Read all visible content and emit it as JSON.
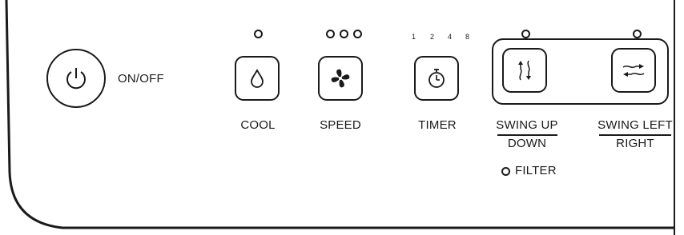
{
  "panel": {
    "power": {
      "label": "ON/OFF",
      "icon": "power-icon"
    },
    "cool": {
      "label": "COOL",
      "icon": "water-drop-icon",
      "indicators": 1
    },
    "speed": {
      "label": "SPEED",
      "icon": "fan-icon",
      "indicators": 3
    },
    "timer": {
      "label": "TIMER",
      "icon": "timer-icon",
      "steps": [
        "1",
        "2",
        "4",
        "8"
      ]
    },
    "swing_ud": {
      "label_top": "SWING UP",
      "label_bottom": "DOWN",
      "icon": "swing-up-down-icon",
      "indicators": 1
    },
    "swing_lr": {
      "label_top": "SWING LEFT",
      "label_bottom": "RIGHT",
      "icon": "swing-left-right-icon",
      "indicators": 1
    },
    "filter": {
      "label": "FILTER"
    }
  },
  "colors": {
    "ink": "#1a1a1a",
    "background": "#ffffff"
  }
}
